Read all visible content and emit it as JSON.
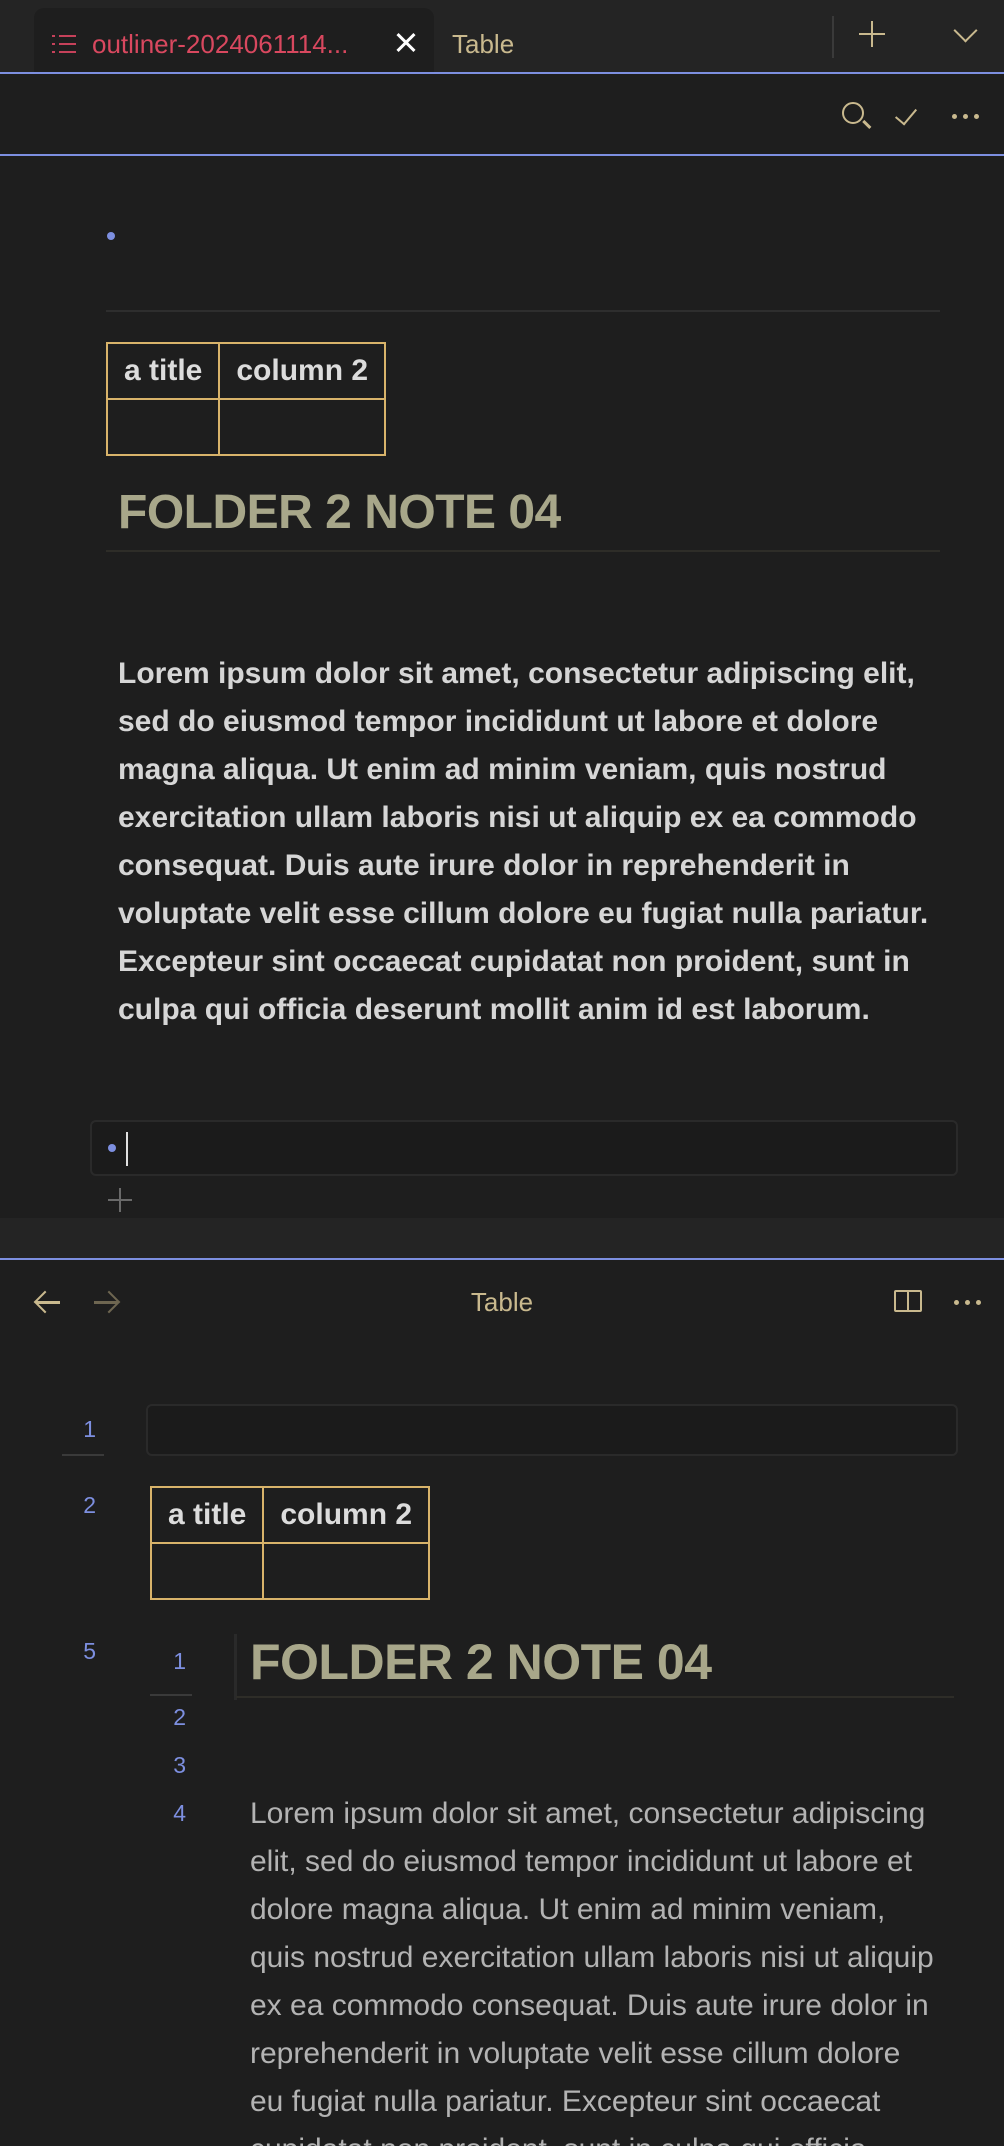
{
  "tabs": [
    {
      "label": "outliner-2024061114...",
      "icon": "outline-list-icon",
      "active": true
    },
    {
      "label": "Table",
      "active": false
    }
  ],
  "colors": {
    "accent": "#7d8fe0",
    "active_tab_text": "#d9485f",
    "table_border": "#d8b36a",
    "heading": "#a8a78a",
    "ui_icon": "#c9b98e"
  },
  "top_pane": {
    "toolbar": {
      "icons": [
        "search-icon",
        "check-icon",
        "more-options-icon"
      ]
    },
    "table": {
      "headers": [
        "a title",
        "column 2"
      ],
      "rows": [
        [
          "",
          ""
        ]
      ]
    },
    "note_title": "FOLDER 2 NOTE 04",
    "paragraph": "Lorem ipsum dolor sit amet, consectetur adipiscing elit, sed do eiusmod tempor incididunt ut labore et dolore magna aliqua. Ut enim ad minim veniam, quis nostrud exercitation ullam laboris nisi ut aliquip ex ea commodo consequat. Duis aute irure dolor in reprehenderit in voluptate velit esse cillum dolore eu fugiat nulla pariatur. Excepteur sint occaecat cupidatat non proident, sunt in culpa qui officia deserunt mollit anim id est laborum."
  },
  "bottom_pane": {
    "title": "Table",
    "outer_line_numbers": [
      "1",
      "2",
      "5"
    ],
    "inner_line_numbers": [
      "1",
      "2",
      "3",
      "4"
    ],
    "table": {
      "headers": [
        "a title",
        "column 2"
      ],
      "rows": [
        [
          "",
          ""
        ]
      ]
    },
    "note_title": "FOLDER 2 NOTE 04",
    "paragraph": "Lorem ipsum dolor sit amet, consectetur adipiscing elit, sed do eiusmod tempor incididunt ut labore et dolore magna aliqua. Ut enim ad minim veniam, quis nostrud exercitation ullam laboris nisi ut aliquip ex ea commodo consequat. Duis aute irure dolor in reprehenderit in voluptate velit esse cillum dolore eu fugiat nulla pariatur. Excepteur sint occaecat cupidatat non proident, sunt in culpa qui officia deserunt mollit anim id est laborum."
  }
}
